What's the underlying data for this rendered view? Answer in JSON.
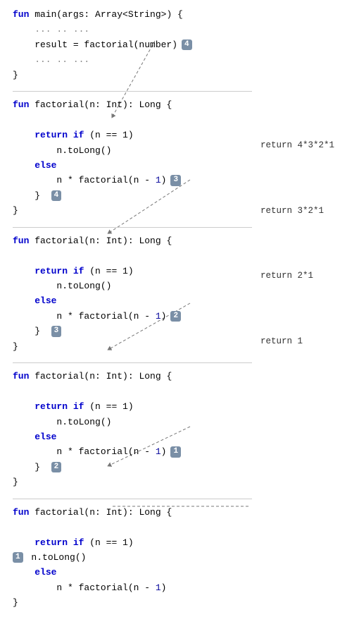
{
  "blocks": [
    {
      "id": "main",
      "lines": [
        {
          "text": "fun main(args: Array<String>) {",
          "parts": [
            {
              "t": "fun ",
              "c": "kw"
            },
            {
              "t": "main",
              "c": "fn-name"
            },
            {
              "t": "(args: Array<String>) {",
              "c": "normal"
            }
          ]
        },
        {
          "text": "    ... .. ..."
        },
        {
          "text": "    result = factorial(number)",
          "hasBadge": true,
          "badge": "4",
          "badgePos": "after"
        },
        {
          "text": "    ... .. ..."
        },
        {
          "text": "}"
        }
      ],
      "annotation": null
    },
    {
      "id": "factorial-4",
      "lines": [
        {
          "text": "fun factorial(n: Int): Long {"
        },
        {
          "text": ""
        },
        {
          "text": "    return if (n == 1)"
        },
        {
          "text": "        n.toLong()"
        },
        {
          "text": "    else"
        },
        {
          "text": "        n * factorial(n - 1)",
          "hasBadge": true,
          "badge": "3",
          "badgeAfter": true
        },
        {
          "text": "    }  4"
        },
        {
          "text": "}"
        }
      ],
      "annotation": "return 4*3*2*1"
    },
    {
      "id": "factorial-3",
      "lines": [
        {
          "text": "fun factorial(n: Int): Long {"
        },
        {
          "text": ""
        },
        {
          "text": "    return if (n == 1)"
        },
        {
          "text": "        n.toLong()"
        },
        {
          "text": "    else"
        },
        {
          "text": "        n * factorial(n - 1)",
          "hasBadge": true,
          "badge": "2",
          "badgeAfter": true
        },
        {
          "text": "    }  3"
        },
        {
          "text": "}"
        }
      ],
      "annotation": "return 3*2*1"
    },
    {
      "id": "factorial-2",
      "lines": [
        {
          "text": "fun factorial(n: Int): Long {"
        },
        {
          "text": ""
        },
        {
          "text": "    return if (n == 1)"
        },
        {
          "text": "        n.toLong()"
        },
        {
          "text": "    else"
        },
        {
          "text": "        n * factorial(n - 1)",
          "hasBadge": true,
          "badge": "1",
          "badgeAfter": true
        },
        {
          "text": "    }  2"
        },
        {
          "text": "}"
        }
      ],
      "annotation": "return 2*1"
    },
    {
      "id": "factorial-1",
      "lines": [
        {
          "text": "fun factorial(n: Int): Long {"
        },
        {
          "text": ""
        },
        {
          "text": "    return if (n == 1)"
        },
        {
          "text": "        n.toLong()",
          "hasBadge": true,
          "badge": "1",
          "badgeBefore": true
        },
        {
          "text": "    else"
        },
        {
          "text": "        n * factorial(n - 1)"
        },
        {
          "text": "}"
        }
      ],
      "annotation": "return 1"
    }
  ]
}
